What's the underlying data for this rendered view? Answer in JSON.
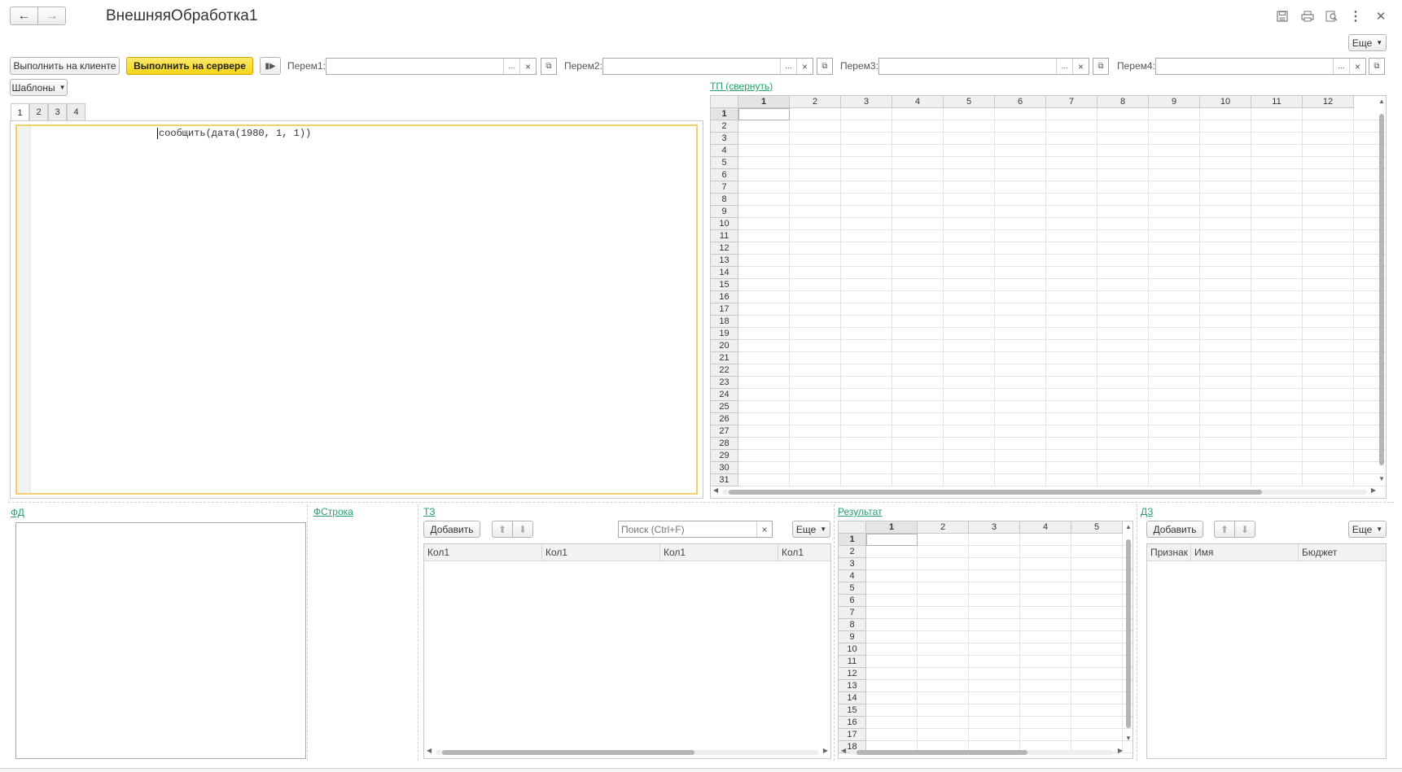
{
  "window": {
    "title": "ВнешняяОбработка1",
    "more_label": "Еще"
  },
  "toolbar": {
    "run_client_label": "Выполнить на клиенте",
    "run_server_label": "Выполнить на сервере",
    "templates_label": "Шаблоны",
    "vars": [
      {
        "label": "Перем1:",
        "value": ""
      },
      {
        "label": "Перем2:",
        "value": ""
      },
      {
        "label": "Перем3:",
        "value": ""
      },
      {
        "label": "Перем4:",
        "value": ""
      }
    ],
    "select_btn": "...",
    "clear_btn": "×"
  },
  "editor": {
    "tabs": [
      "1",
      "2",
      "3",
      "4"
    ],
    "active_tab": "1",
    "code": "сообщить(дата(1980, 1, 1))"
  },
  "tp": {
    "link_label": "ТП (свернуть)",
    "columns": [
      "1",
      "2",
      "3",
      "4",
      "5",
      "6",
      "7",
      "8",
      "9",
      "10",
      "11",
      "12"
    ],
    "rows": [
      "1",
      "2",
      "3",
      "4",
      "5",
      "6",
      "7",
      "8",
      "9",
      "10",
      "11",
      "12",
      "13",
      "14",
      "15",
      "16",
      "17",
      "18",
      "19",
      "20",
      "21",
      "22",
      "23",
      "24",
      "25",
      "26",
      "27",
      "28",
      "29",
      "30",
      "31"
    ]
  },
  "fd": {
    "link_label": "ФД"
  },
  "fstroka": {
    "link_label": "ФСтрока"
  },
  "tz": {
    "link_label": "ТЗ",
    "add_label": "Добавить",
    "search_placeholder": "Поиск (Ctrl+F)",
    "more_label": "Еще",
    "columns": [
      "Кол1",
      "Кол1",
      "Кол1",
      "Кол1"
    ]
  },
  "result": {
    "link_label": "Результат",
    "columns": [
      "1",
      "2",
      "3",
      "4",
      "5"
    ],
    "rows": [
      "1",
      "2",
      "3",
      "4",
      "5",
      "6",
      "7",
      "8",
      "9",
      "10",
      "11",
      "12",
      "13",
      "14",
      "15",
      "16",
      "17",
      "18"
    ]
  },
  "dz": {
    "link_label": "ДЗ",
    "add_label": "Добавить",
    "more_label": "Еще",
    "columns": [
      "Признак",
      "Имя",
      "Бюджет"
    ]
  }
}
